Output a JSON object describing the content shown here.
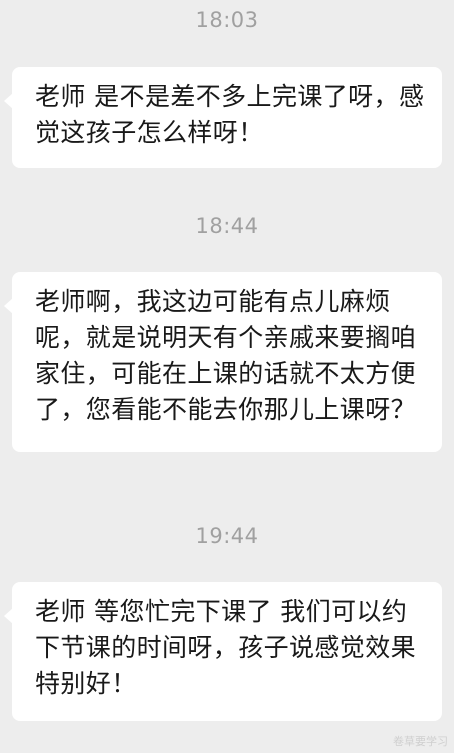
{
  "messages": [
    {
      "time": "18:03",
      "text": "老师 是不是差不多上完课了呀，感觉这孩子怎么样呀！"
    },
    {
      "time": "18:44",
      "text": "老师啊，我这边可能有点儿麻烦呢，就是说明天有个亲戚来要搁咱家住，可能在上课的话就不太方便了，您看能不能去你那儿上课呀？"
    },
    {
      "time": "19:44",
      "text": "老师 等您忙完下课了 我们可以约下节课的时间呀，孩子说感觉效果特别好！"
    }
  ],
  "watermark": "卷草要学习",
  "colors": {
    "background": "#ededed",
    "bubble": "#ffffff",
    "timestamp": "#a0a0a0",
    "text": "#191919"
  }
}
